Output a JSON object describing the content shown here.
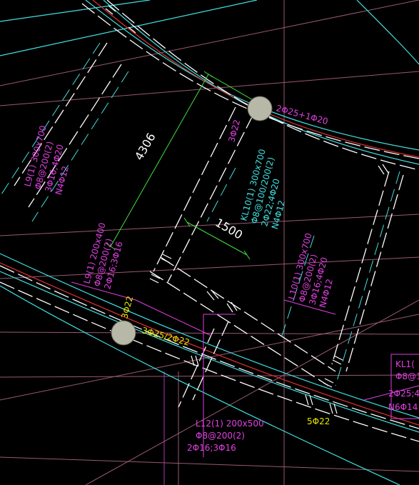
{
  "colors": {
    "background": "#000000",
    "beam_edge": "#ffffff",
    "axis_line": "#40e0e0",
    "rebar_line": "#e03030",
    "dimension_line": "#40e040",
    "grid_line": "#c07090",
    "annotation_magenta": "#e040e0",
    "annotation_yellow": "#e8e800",
    "annotation_cyan": "#40e0e0",
    "column": "#b8b8a8"
  },
  "dimensions": {
    "long_span": "4306",
    "short_span": "1500"
  },
  "annotations": {
    "l9_upper": [
      "L9(1) 300x700",
      "Φ8@200(2)",
      "3Φ16;4Φ20",
      "N4Φ12"
    ],
    "l9_lower": [
      "L9(1) 200x400",
      "Φ8@200(2)",
      "2Φ16;3Φ16"
    ],
    "kl10": [
      "KL10(1) 300x700",
      "Φ8@100/200(2)",
      "2Φ22;4Φ20",
      "N4Φ12"
    ],
    "l10": [
      "L10(1) 300x700",
      "Φ8@200(2)",
      "3Φ16;4Φ20",
      "N4Φ12"
    ],
    "l12": [
      "L12(1) 200x500",
      "Φ8@200(2)",
      "2Φ16;3Φ16"
    ],
    "kl_right": [
      "KL1(",
      "Φ8@10",
      "2Φ25;4",
      "N6Φ14"
    ],
    "rebar_top_column": "2Φ25+1Φ20",
    "rebar_kl10_side": "3Φ22",
    "rebar_left_column": "3Φ22",
    "rebar_bottom_beam": "3Φ25/2Φ22",
    "rebar_bottom_right": "5Φ22"
  }
}
